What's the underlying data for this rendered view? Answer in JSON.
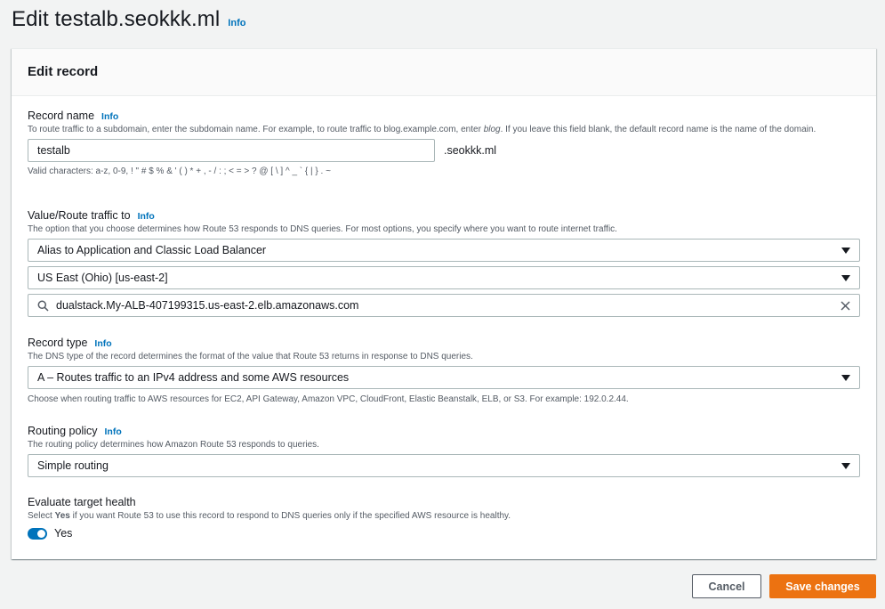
{
  "header": {
    "title": "Edit testalb.seokkk.ml",
    "info": "Info"
  },
  "panel": {
    "title": "Edit record"
  },
  "record_name": {
    "label": "Record name",
    "info": "Info",
    "desc_prefix": "To route traffic to a subdomain, enter the subdomain name. For example, to route traffic to blog.example.com, enter ",
    "desc_italic": "blog",
    "desc_suffix": ". If you leave this field blank, the default record name is the name of the domain.",
    "value": "testalb",
    "suffix": ".seokkk.ml",
    "valid_chars": "Valid characters: a-z, 0-9, ! \" # $ % & ' ( ) * + , - / : ; < = > ? @ [ \\ ] ^ _ ` { | } . ~"
  },
  "route_traffic": {
    "label": "Value/Route traffic to",
    "info": "Info",
    "desc": "The option that you choose determines how Route 53 responds to DNS queries. For most options, you specify where you want to route internet traffic.",
    "endpoint": "Alias to Application and Classic Load Balancer",
    "region": "US East (Ohio) [us-east-2]",
    "load_balancer": "dualstack.My-ALB-407199315.us-east-2.elb.amazonaws.com"
  },
  "record_type": {
    "label": "Record type",
    "info": "Info",
    "desc": "The DNS type of the record determines the format of the value that Route 53 returns in response to DNS queries.",
    "value": "A – Routes traffic to an IPv4 address and some AWS resources",
    "hint": "Choose when routing traffic to AWS resources for EC2, API Gateway, Amazon VPC, CloudFront, Elastic Beanstalk, ELB, or S3. For example: 192.0.2.44."
  },
  "routing_policy": {
    "label": "Routing policy",
    "info": "Info",
    "desc": "The routing policy determines how Amazon Route 53 responds to queries.",
    "value": "Simple routing"
  },
  "evaluate_health": {
    "label": "Evaluate target health",
    "desc_prefix": "Select ",
    "desc_bold": "Yes",
    "desc_suffix": " if you want Route 53 to use this record to respond to DNS queries only if the specified AWS resource is healthy.",
    "toggle_label": "Yes"
  },
  "actions": {
    "cancel": "Cancel",
    "save": "Save changes"
  },
  "colors": {
    "primary": "#ec7211",
    "link": "#0073bb",
    "toggle": "#0073bb"
  }
}
